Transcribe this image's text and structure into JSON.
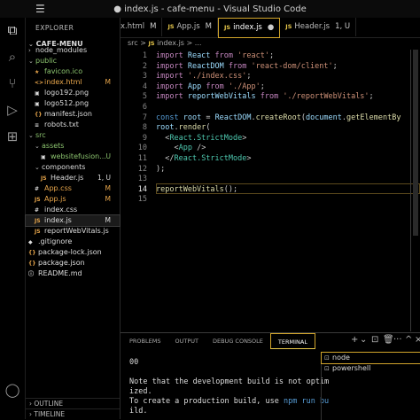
{
  "window": {
    "title": "● index.js - cafe-menu - Visual Studio Code",
    "menu_glyph": "☰"
  },
  "activity_bar": [
    {
      "name": "explorer-icon",
      "glyph": "⧉"
    },
    {
      "name": "search-icon",
      "glyph": "⌕"
    },
    {
      "name": "source-control-icon",
      "glyph": "⑂"
    },
    {
      "name": "run-debug-icon",
      "glyph": "▷"
    },
    {
      "name": "extensions-icon",
      "glyph": "⊞"
    },
    {
      "name": "accounts-icon",
      "glyph": "◯"
    }
  ],
  "sidebar": {
    "header": "EXPLORER",
    "root": "CAFE-MENU",
    "tree": [
      {
        "label": "node_modules",
        "type": "folder",
        "depth": 1,
        "open": false,
        "color": "white"
      },
      {
        "label": "public",
        "type": "folder",
        "depth": 1,
        "open": true,
        "color": "green"
      },
      {
        "label": "favicon.ico",
        "type": "file",
        "depth": 2,
        "icon": "★",
        "icon_color": "orange",
        "color": "green"
      },
      {
        "label": "index.html",
        "type": "file",
        "depth": 2,
        "icon": "<>",
        "icon_color": "orange",
        "color": "orange",
        "badge": "M"
      },
      {
        "label": "logo192.png",
        "type": "file",
        "depth": 2,
        "icon": "▣",
        "icon_color": "white",
        "color": "white"
      },
      {
        "label": "logo512.png",
        "type": "file",
        "depth": 2,
        "icon": "▣",
        "icon_color": "white",
        "color": "white"
      },
      {
        "label": "manifest.json",
        "type": "file",
        "depth": 2,
        "icon": "{}",
        "icon_color": "orange",
        "color": "white"
      },
      {
        "label": "robots.txt",
        "type": "file",
        "depth": 2,
        "icon": "≡",
        "icon_color": "white",
        "color": "white"
      },
      {
        "label": "src",
        "type": "folder",
        "depth": 1,
        "open": true,
        "color": "green"
      },
      {
        "label": "assets",
        "type": "folder",
        "depth": 2,
        "open": true,
        "color": "green"
      },
      {
        "label": "websitefusion...",
        "type": "file",
        "depth": 3,
        "icon": "▣",
        "icon_color": "white",
        "color": "green",
        "badge": "U"
      },
      {
        "label": "components",
        "type": "folder",
        "depth": 2,
        "open": true,
        "color": "white"
      },
      {
        "label": "Header.js",
        "type": "file",
        "depth": 3,
        "icon": "JS",
        "icon_color": "orange",
        "color": "white",
        "badge": "1, U"
      },
      {
        "label": "App.css",
        "type": "file",
        "depth": 2,
        "icon": "#",
        "icon_color": "white",
        "color": "orange",
        "badge": "M"
      },
      {
        "label": "App.js",
        "type": "file",
        "depth": 2,
        "icon": "JS",
        "icon_color": "orange",
        "color": "orange",
        "badge": "M"
      },
      {
        "label": "index.css",
        "type": "file",
        "depth": 2,
        "icon": "#",
        "icon_color": "white",
        "color": "white"
      },
      {
        "label": "index.js",
        "type": "file",
        "depth": 2,
        "icon": "JS",
        "icon_color": "orange",
        "color": "white",
        "badge": "M",
        "selected": true
      },
      {
        "label": "reportWebVitals.js",
        "type": "file",
        "depth": 2,
        "icon": "JS",
        "icon_color": "orange",
        "color": "white"
      },
      {
        "label": ".gitignore",
        "type": "file",
        "depth": 1,
        "icon": "◆",
        "icon_color": "white",
        "color": "white"
      },
      {
        "label": "package-lock.json",
        "type": "file",
        "depth": 1,
        "icon": "{}",
        "icon_color": "orange",
        "color": "white"
      },
      {
        "label": "package.json",
        "type": "file",
        "depth": 1,
        "icon": "{}",
        "icon_color": "orange",
        "color": "white"
      },
      {
        "label": "README.md",
        "type": "file",
        "depth": 1,
        "icon": "ⓘ",
        "icon_color": "white",
        "color": "white"
      }
    ],
    "sections": [
      "OUTLINE",
      "TIMELINE"
    ]
  },
  "tabs": [
    {
      "label": "x.html",
      "badge": "M",
      "js": false,
      "active": false
    },
    {
      "label": "App.js",
      "badge": "M",
      "js": true,
      "active": false
    },
    {
      "label": "index.js",
      "badge": "●",
      "js": true,
      "active": true
    },
    {
      "label": "Header.js",
      "badge": "1, U",
      "js": true,
      "active": false
    }
  ],
  "breadcrumb": {
    "folder": "src",
    "sep": ">",
    "file": "index.js",
    "more": "> ..."
  },
  "editor": {
    "current_line": 14,
    "lines": [
      [
        [
          "k",
          "import "
        ],
        [
          "v",
          "React "
        ],
        [
          "k",
          "from "
        ],
        [
          "s",
          "'react'"
        ],
        [
          "p",
          ";"
        ]
      ],
      [
        [
          "k",
          "import "
        ],
        [
          "v",
          "ReactDOM "
        ],
        [
          "k",
          "from "
        ],
        [
          "s",
          "'react-dom/client'"
        ],
        [
          "p",
          ";"
        ]
      ],
      [
        [
          "k",
          "import "
        ],
        [
          "s",
          "'./index.css'"
        ],
        [
          "p",
          ";"
        ]
      ],
      [
        [
          "k",
          "import "
        ],
        [
          "v",
          "App "
        ],
        [
          "k",
          "from "
        ],
        [
          "s",
          "'./App'"
        ],
        [
          "p",
          ";"
        ]
      ],
      [
        [
          "k",
          "import "
        ],
        [
          "v",
          "reportWebVitals "
        ],
        [
          "k",
          "from "
        ],
        [
          "s",
          "'./reportWebVitals'"
        ],
        [
          "p",
          ";"
        ]
      ],
      [],
      [
        [
          "kw",
          "const "
        ],
        [
          "v",
          "root "
        ],
        [
          "p",
          "= "
        ],
        [
          "v",
          "ReactDOM"
        ],
        [
          "p",
          "."
        ],
        [
          "f",
          "createRoot"
        ],
        [
          "p",
          "("
        ],
        [
          "v",
          "document"
        ],
        [
          "p",
          "."
        ],
        [
          "f",
          "getElementBy"
        ]
      ],
      [
        [
          "v",
          "root"
        ],
        [
          "p",
          "."
        ],
        [
          "f",
          "render"
        ],
        [
          "p",
          "("
        ]
      ],
      [
        [
          "p",
          "  <"
        ],
        [
          "t",
          "React.StrictMode"
        ],
        [
          "p",
          ">"
        ]
      ],
      [
        [
          "p",
          "    <"
        ],
        [
          "t",
          "App "
        ],
        [
          "p",
          "/>"
        ]
      ],
      [
        [
          "p",
          "  </"
        ],
        [
          "t",
          "React.StrictMode"
        ],
        [
          "p",
          ">"
        ]
      ],
      [
        [
          "p",
          ");"
        ]
      ],
      [],
      [
        [
          "f",
          "reportWebVitals"
        ],
        [
          "p",
          "();"
        ]
      ],
      []
    ]
  },
  "panel": {
    "tabs": [
      "PROBLEMS",
      "OUTPUT",
      "DEBUG CONSOLE",
      "TERMINAL"
    ],
    "active_tab": "TERMINAL",
    "icons": [
      {
        "name": "new-terminal-icon",
        "glyph": "+"
      },
      {
        "name": "terminal-dropdown-icon",
        "glyph": "⌄"
      },
      {
        "name": "split-terminal-icon",
        "glyph": "⊡"
      },
      {
        "name": "kill-terminal-icon",
        "glyph": "🗑"
      },
      {
        "name": "more-actions-icon",
        "glyph": "···"
      },
      {
        "name": "maximize-panel-icon",
        "glyph": "^"
      },
      {
        "name": "close-panel-icon",
        "glyph": "×"
      }
    ],
    "terminal_lines": [
      "00",
      "",
      "Note that the development build is not optim",
      "ized.",
      "To create a production build, use "
    ],
    "terminal_link": "npm run bu",
    "terminal_last": "ild.",
    "terminals": [
      {
        "label": "node",
        "selected": true
      },
      {
        "label": "powershell",
        "selected": false
      }
    ]
  }
}
